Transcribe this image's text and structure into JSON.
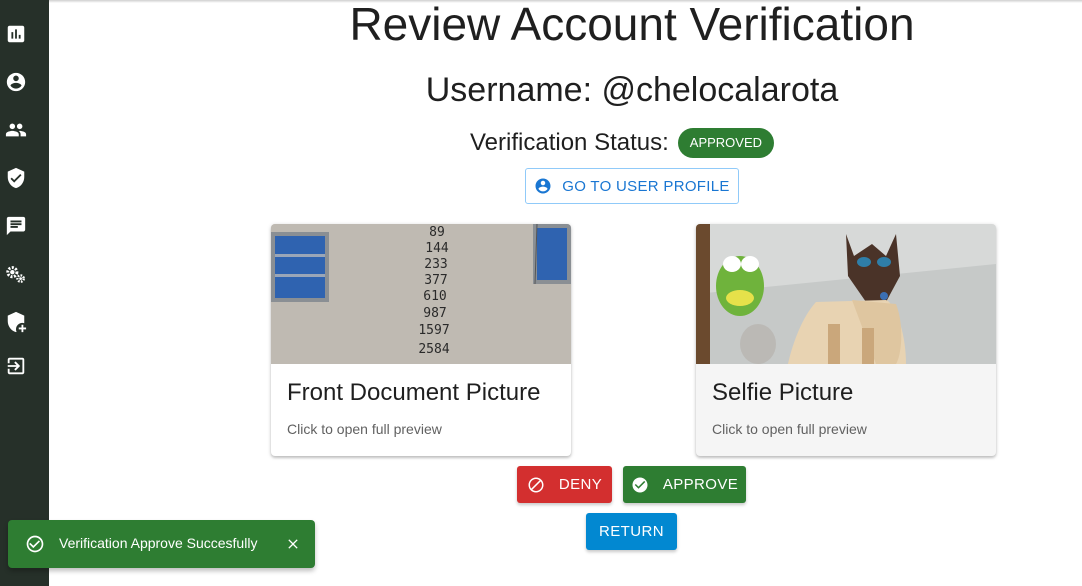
{
  "sidebar": {
    "items": [
      {
        "icon": "dashboard-chart-icon"
      },
      {
        "icon": "account-circle-icon"
      },
      {
        "icon": "people-group-icon"
      },
      {
        "icon": "verified-shield-check-icon"
      },
      {
        "icon": "chat-message-icon"
      },
      {
        "icon": "settings-gears-icon"
      },
      {
        "icon": "shield-add-icon"
      },
      {
        "icon": "logout-icon"
      }
    ],
    "background": "#263029"
  },
  "page": {
    "title": "Review Account Verification",
    "username": "Username: @chelocalarota",
    "status_label": "Verification Status:",
    "status_value": "APPROVED",
    "profile_button": "GO TO USER PROFILE"
  },
  "cards": [
    {
      "title": "Front Document Picture",
      "subtitle": "Click to open full preview",
      "image_text": [
        "89",
        "144",
        "233",
        "377",
        "610",
        "987",
        "1597",
        "2584"
      ]
    },
    {
      "title": "Selfie Picture",
      "subtitle": "Click to open full preview"
    }
  ],
  "actions": {
    "deny": "DENY",
    "approve": "APPROVE",
    "return": "RETURN"
  },
  "toast": {
    "message": "Verification Approve Succesfully",
    "close_icon": "close-icon"
  },
  "colors": {
    "success": "#2e7d32",
    "error": "#d32f2f",
    "info": "#0288d1",
    "primary": "#1976d2"
  }
}
